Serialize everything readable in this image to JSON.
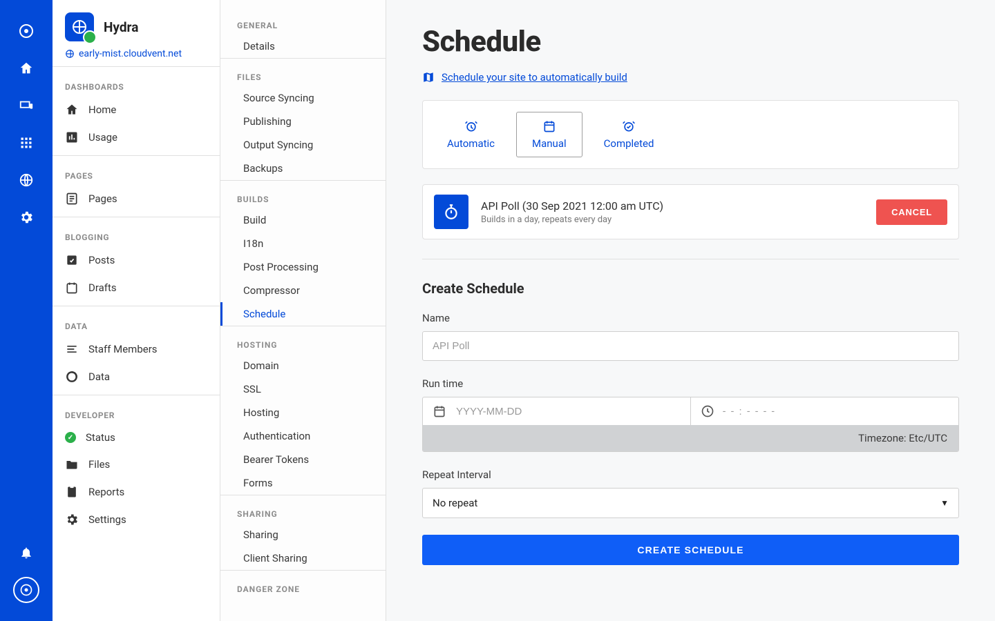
{
  "site": {
    "name": "Hydra",
    "url": "early-mist.cloudvent.net"
  },
  "sidebar": {
    "sections": [
      {
        "heading": "DASHBOARDS",
        "items": [
          "Home",
          "Usage"
        ]
      },
      {
        "heading": "PAGES",
        "items": [
          "Pages"
        ]
      },
      {
        "heading": "BLOGGING",
        "items": [
          "Posts",
          "Drafts"
        ]
      },
      {
        "heading": "DATA",
        "items": [
          "Staff Members",
          "Data"
        ]
      },
      {
        "heading": "DEVELOPER",
        "items": [
          "Status",
          "Files",
          "Reports",
          "Settings"
        ]
      }
    ]
  },
  "settings_nav": {
    "groups": [
      {
        "heading": "GENERAL",
        "items": [
          "Details"
        ]
      },
      {
        "heading": "FILES",
        "items": [
          "Source Syncing",
          "Publishing",
          "Output Syncing",
          "Backups"
        ]
      },
      {
        "heading": "BUILDS",
        "items": [
          "Build",
          "I18n",
          "Post Processing",
          "Compressor",
          "Schedule"
        ],
        "active": "Schedule"
      },
      {
        "heading": "HOSTING",
        "items": [
          "Domain",
          "SSL",
          "Hosting",
          "Authentication",
          "Bearer Tokens",
          "Forms"
        ]
      },
      {
        "heading": "SHARING",
        "items": [
          "Sharing",
          "Client Sharing"
        ]
      },
      {
        "heading": "DANGER ZONE",
        "items": []
      }
    ]
  },
  "page": {
    "title": "Schedule",
    "doc_link": "Schedule your site to automatically build",
    "tabs": {
      "automatic": "Automatic",
      "manual": "Manual",
      "completed": "Completed",
      "active": "manual"
    },
    "scheduled": {
      "title": "API Poll (30 Sep 2021 12:00 am UTC)",
      "sub": "Builds in a day, repeats every day",
      "cancel": "CANCEL"
    },
    "form": {
      "heading": "Create Schedule",
      "name_label": "Name",
      "name_placeholder": "API Poll",
      "runtime_label": "Run time",
      "date_placeholder": "YYYY-MM-DD",
      "time_placeholder": "- - : - -  - -",
      "tz_label": "Timezone: Etc/UTC",
      "repeat_label": "Repeat Interval",
      "repeat_value": "No repeat",
      "submit": "CREATE SCHEDULE"
    }
  }
}
